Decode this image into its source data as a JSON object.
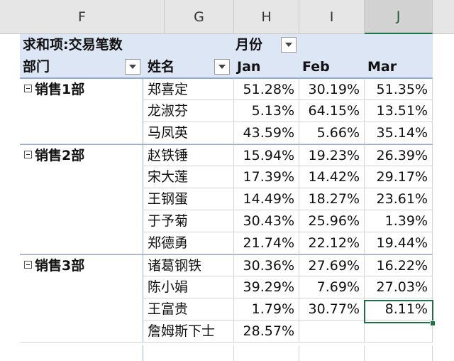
{
  "columns": [
    "F",
    "G",
    "H",
    "I",
    "J"
  ],
  "pivot": {
    "value_label": "求和项:交易笔数",
    "col_field": "月份",
    "row_field_1": "部门",
    "row_field_2": "姓名",
    "months": [
      "Jan",
      "Feb",
      "Mar"
    ]
  },
  "rows": [
    {
      "dept": "销售1部",
      "name": "郑喜定",
      "values": [
        "51.28%",
        "30.19%",
        "51.35%"
      ]
    },
    {
      "dept": "",
      "name": "龙淑芬",
      "values": [
        "5.13%",
        "64.15%",
        "13.51%"
      ]
    },
    {
      "dept": "",
      "name": "马凤英",
      "values": [
        "43.59%",
        "5.66%",
        "35.14%"
      ]
    },
    {
      "dept": "销售2部",
      "name": "赵铁锤",
      "values": [
        "15.94%",
        "19.23%",
        "26.39%"
      ]
    },
    {
      "dept": "",
      "name": "宋大莲",
      "values": [
        "17.39%",
        "14.42%",
        "29.17%"
      ]
    },
    {
      "dept": "",
      "name": "王钢蛋",
      "values": [
        "14.49%",
        "18.27%",
        "23.61%"
      ]
    },
    {
      "dept": "",
      "name": "于予菊",
      "values": [
        "30.43%",
        "25.96%",
        "1.39%"
      ]
    },
    {
      "dept": "",
      "name": "郑德勇",
      "values": [
        "21.74%",
        "22.12%",
        "19.44%"
      ]
    },
    {
      "dept": "销售3部",
      "name": "诸葛钢铁",
      "values": [
        "30.36%",
        "27.69%",
        "16.22%"
      ]
    },
    {
      "dept": "",
      "name": "陈小娟",
      "values": [
        "39.29%",
        "7.69%",
        "27.03%"
      ]
    },
    {
      "dept": "",
      "name": "王富贵",
      "values": [
        "1.79%",
        "30.77%",
        "8.11%"
      ]
    },
    {
      "dept": "",
      "name": "詹姆斯下士",
      "values": [
        "28.57%",
        "",
        ""
      ]
    }
  ],
  "selected_column": "J",
  "colors": {
    "header_fill": "#dde6f4",
    "selection": "#1e7145",
    "gridline": "#d4d4d4"
  }
}
